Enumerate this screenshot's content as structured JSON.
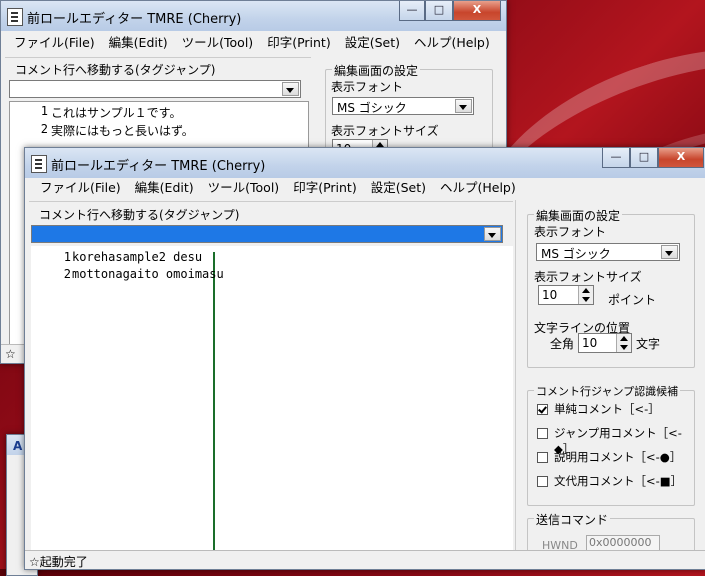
{
  "colors": {
    "titlebar": "#c2d3ea",
    "selection": "#1e78e6",
    "close": "#c8452c",
    "desktop": "#8c0a16"
  },
  "back_window": {
    "title": "前ロールエディター TMRE (Cherry)",
    "controls": {
      "minimize": "—",
      "maximize": "□",
      "close": "X"
    },
    "menu": [
      "ファイル(File)",
      "編集(Edit)",
      "ツール(Tool)",
      "印字(Print)",
      "設定(Set)",
      "ヘルプ(Help)"
    ],
    "jump_label": "コメント行へ移動する(タグジャンプ)",
    "lines": [
      {
        "num": "1",
        "text": "これはサンプル１です。"
      },
      {
        "num": "2",
        "text": "実際にはもっと長いはず。"
      }
    ],
    "display_group_title": "編集画面の設定",
    "font_label": "表示フォント",
    "font_value": "MS ゴシック",
    "font_size_label": "表示フォントサイズ",
    "font_size_value": "10",
    "status": "☆"
  },
  "front_window": {
    "title": "前ロールエディター TMRE (Cherry)",
    "controls": {
      "minimize": "—",
      "maximize": "□",
      "close": "X"
    },
    "menu": [
      "ファイル(File)",
      "編集(Edit)",
      "ツール(Tool)",
      "印字(Print)",
      "設定(Set)",
      "ヘルプ(Help)"
    ],
    "jump_label": "コメント行へ移動する(タグジャンプ)",
    "jump_value": "",
    "lines": [
      {
        "num": "1",
        "text": "korehasample2 desu"
      },
      {
        "num": "2",
        "text": "mottonagaito omoimasu"
      }
    ],
    "display_settings": {
      "title": "編集画面の設定",
      "font_label": "表示フォント",
      "font_value": "MS ゴシック",
      "font_size_label": "表示フォントサイズ",
      "font_size_value": "10",
      "point_label": "ポイント",
      "line_pos_label": "文字ラインの位置",
      "zenkaku_label": "全角",
      "line_pos_value": "10",
      "moji_label": "文字"
    },
    "jump_candidates": {
      "title": "コメント行ジャンプ認識候補",
      "items": [
        {
          "label": "単純コメント［<-］",
          "checked": true
        },
        {
          "label": "ジャンプ用コメント［<-◆］",
          "checked": false
        },
        {
          "label": "説明用コメント［<-●］",
          "checked": false
        },
        {
          "label": "文代用コメント［<-■］",
          "checked": false
        }
      ]
    },
    "send_command": {
      "title": "送信コマンド",
      "hwnd_label": "HWND",
      "hwnd_value": "0x0000000"
    },
    "status": "☆起動完了"
  },
  "third_window": {
    "icon": "A"
  }
}
